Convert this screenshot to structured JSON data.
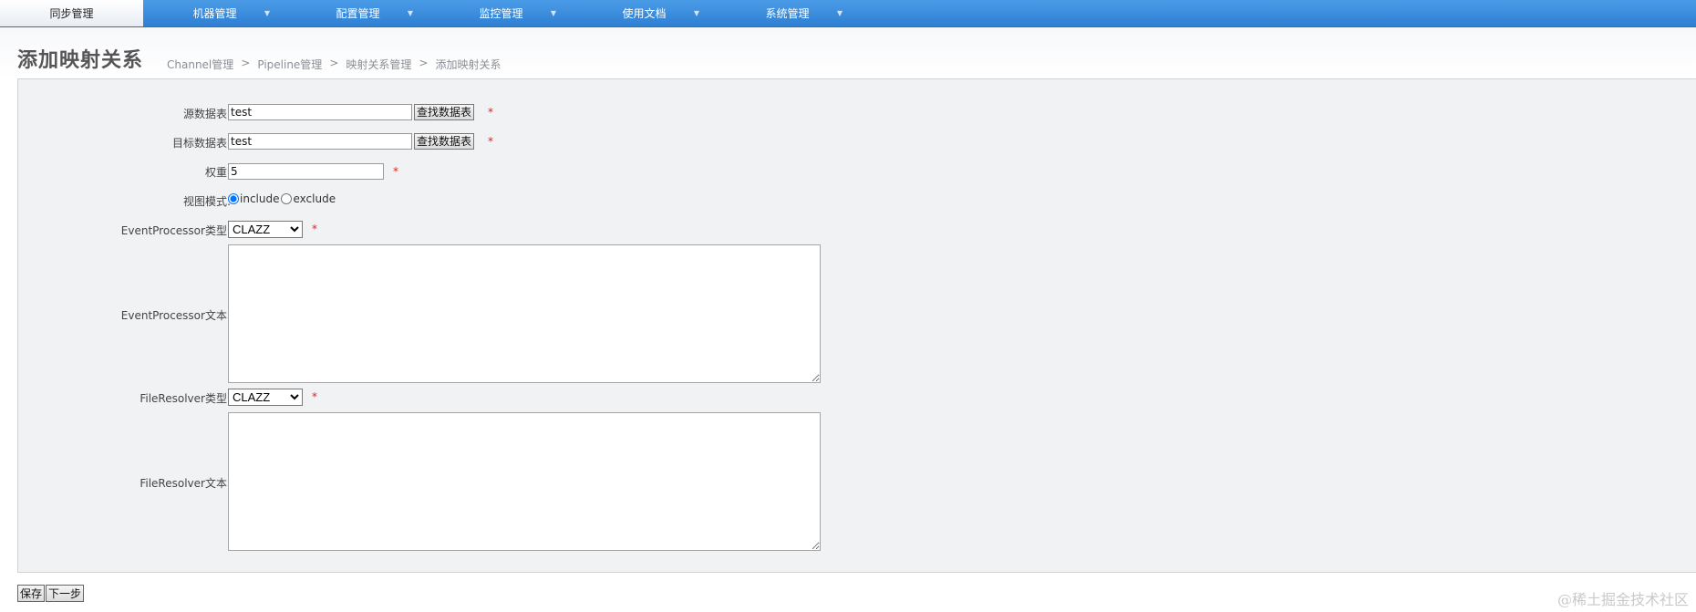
{
  "nav": {
    "items": [
      {
        "label": "同步管理"
      },
      {
        "label": "机器管理"
      },
      {
        "label": "配置管理"
      },
      {
        "label": "监控管理"
      },
      {
        "label": "使用文档"
      },
      {
        "label": "系统管理"
      }
    ],
    "caret": "▼"
  },
  "page": {
    "title": "添加映射关系"
  },
  "breadcrumb": {
    "items": [
      "Channel管理",
      "Pipeline管理",
      "映射关系管理",
      "添加映射关系"
    ],
    "separator": ">"
  },
  "form": {
    "source_table": {
      "label": "源数据表:",
      "value": "test",
      "button": "查找数据表"
    },
    "target_table": {
      "label": "目标数据表:",
      "value": "test",
      "button": "查找数据表"
    },
    "weight": {
      "label": "权重:",
      "value": "5"
    },
    "view_mode": {
      "label": "视图模式:",
      "options": [
        "include",
        "exclude"
      ],
      "selected": "include"
    },
    "event_processor_type": {
      "label": "EventProcessor类型:",
      "value": "CLAZZ"
    },
    "event_processor_text": {
      "label": "EventProcessor文本:",
      "value": ""
    },
    "file_resolver_type": {
      "label": "FileResolver类型:",
      "value": "CLAZZ"
    },
    "file_resolver_text": {
      "label": "FileResolver文本:",
      "value": ""
    },
    "required_mark": "*"
  },
  "actions": {
    "save": "保存",
    "next": "下一步"
  },
  "watermark": "@稀土掘金技术社区"
}
